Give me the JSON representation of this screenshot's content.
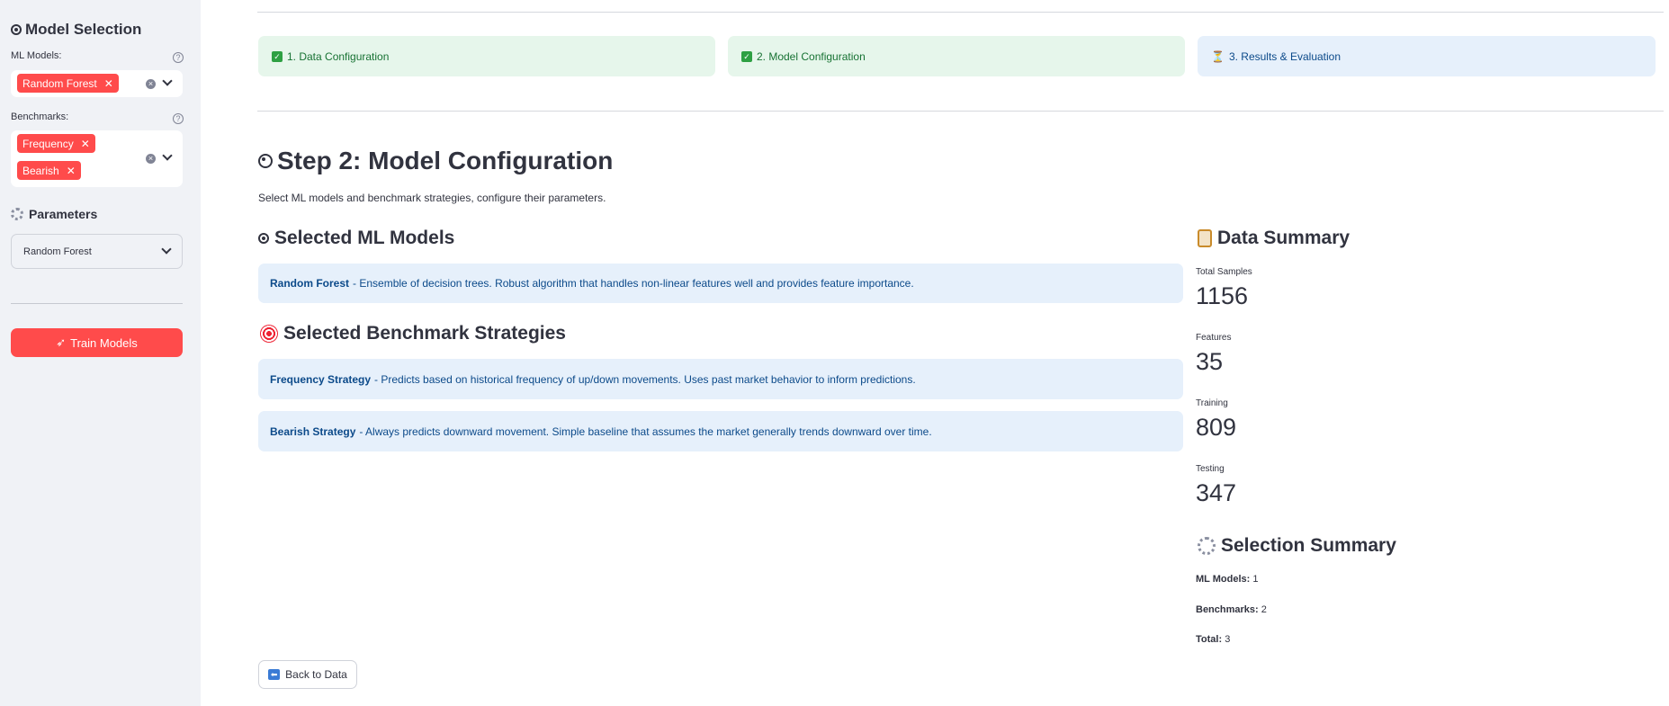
{
  "sidebar": {
    "title": "Model Selection",
    "ml_models_label": "ML Models:",
    "ml_models_selected": [
      "Random Forest"
    ],
    "benchmarks_label": "Benchmarks:",
    "benchmarks_selected": [
      "Frequency",
      "Bearish"
    ],
    "parameters_title": "Parameters",
    "parameters_select_value": "Random Forest",
    "train_button": "Train Models"
  },
  "steps": [
    {
      "label": "1. Data Configuration",
      "status": "done"
    },
    {
      "label": "2. Model Configuration",
      "status": "done"
    },
    {
      "label": "3. Results & Evaluation",
      "status": "pending"
    }
  ],
  "main": {
    "title": "Step 2: Model Configuration",
    "description": "Select ML models and benchmark strategies, configure their parameters.",
    "ml_section_title": "Selected ML Models",
    "ml_models": [
      {
        "name": "Random Forest",
        "text": "- Ensemble of decision trees. Robust algorithm that handles non-linear features well and provides feature importance."
      }
    ],
    "benchmark_section_title": "Selected Benchmark Strategies",
    "benchmarks": [
      {
        "name": "Frequency Strategy",
        "text": "- Predicts based on historical frequency of up/down movements. Uses past market behavior to inform predictions."
      },
      {
        "name": "Bearish Strategy",
        "text": "- Always predicts downward movement. Simple baseline that assumes the market generally trends downward over time."
      }
    ],
    "back_button": "Back to Data"
  },
  "data_summary": {
    "title": "Data Summary",
    "metrics": [
      {
        "label": "Total Samples",
        "value": "1156"
      },
      {
        "label": "Features",
        "value": "35"
      },
      {
        "label": "Training",
        "value": "809"
      },
      {
        "label": "Testing",
        "value": "347"
      }
    ]
  },
  "selection_summary": {
    "title": "Selection Summary",
    "ml_models_label": "ML Models:",
    "ml_models_value": "1",
    "benchmarks_label": "Benchmarks:",
    "benchmarks_value": "2",
    "total_label": "Total:",
    "total_value": "3"
  },
  "colors": {
    "accent": "#ff4b4b",
    "success_bg": "#e6f6eb",
    "info_bg": "#e6f0fb",
    "sidebar_bg": "#f0f2f6"
  }
}
